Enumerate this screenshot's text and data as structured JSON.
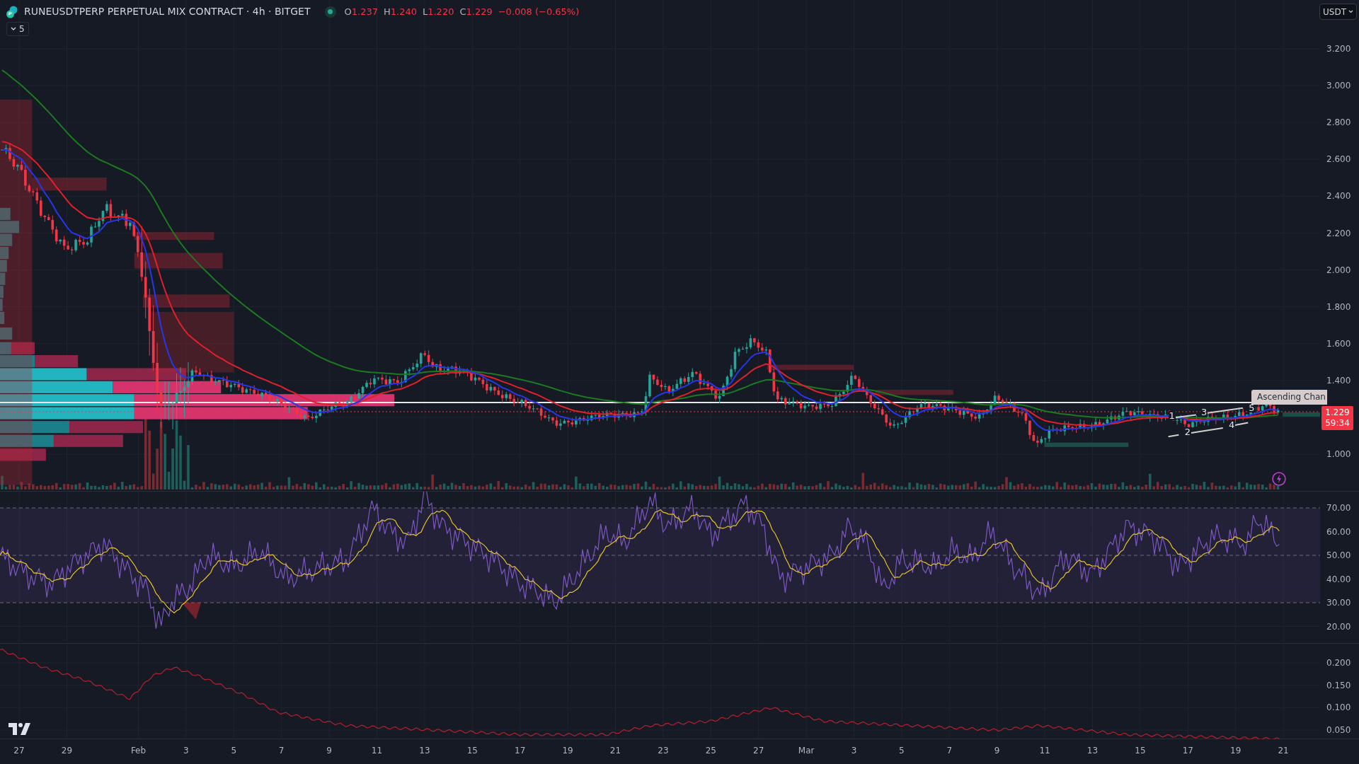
{
  "header": {
    "symbol": "RUNEUSDTPERP PERPETUAL MIX CONTRACT · 4h · BITGET",
    "ohlc": [
      {
        "label": "O",
        "value": "1.237"
      },
      {
        "label": "H",
        "value": "1.240"
      },
      {
        "label": "L",
        "value": "1.220"
      },
      {
        "label": "C",
        "value": "1.229"
      }
    ],
    "change": "−0.008 (−0.65%)"
  },
  "indicator_toggle": {
    "count": "5"
  },
  "currency_button": "USDT",
  "price_axis": [
    "3.200",
    "3.000",
    "2.800",
    "2.600",
    "2.400",
    "2.200",
    "2.000",
    "1.800",
    "1.600",
    "1.400",
    "1.000"
  ],
  "price_tag": {
    "price": "1.229",
    "countdown": "59:34"
  },
  "drawing_labels": {
    "channel": "Ascending Chan",
    "waves": [
      "1",
      "2",
      "3",
      "4",
      "5"
    ]
  },
  "rsi_axis": [
    "70.00",
    "60.00",
    "50.00",
    "40.00",
    "30.00",
    "20.00"
  ],
  "oscillator_axis": [
    "0.200",
    "0.150",
    "0.100",
    "0.050"
  ],
  "time_axis": [
    "27",
    "29",
    "Feb",
    "3",
    "5",
    "7",
    "9",
    "11",
    "13",
    "15",
    "17",
    "19",
    "21",
    "23",
    "25",
    "27",
    "Mar",
    "3",
    "5",
    "7",
    "9",
    "11",
    "13",
    "15",
    "17",
    "19",
    "21"
  ]
}
